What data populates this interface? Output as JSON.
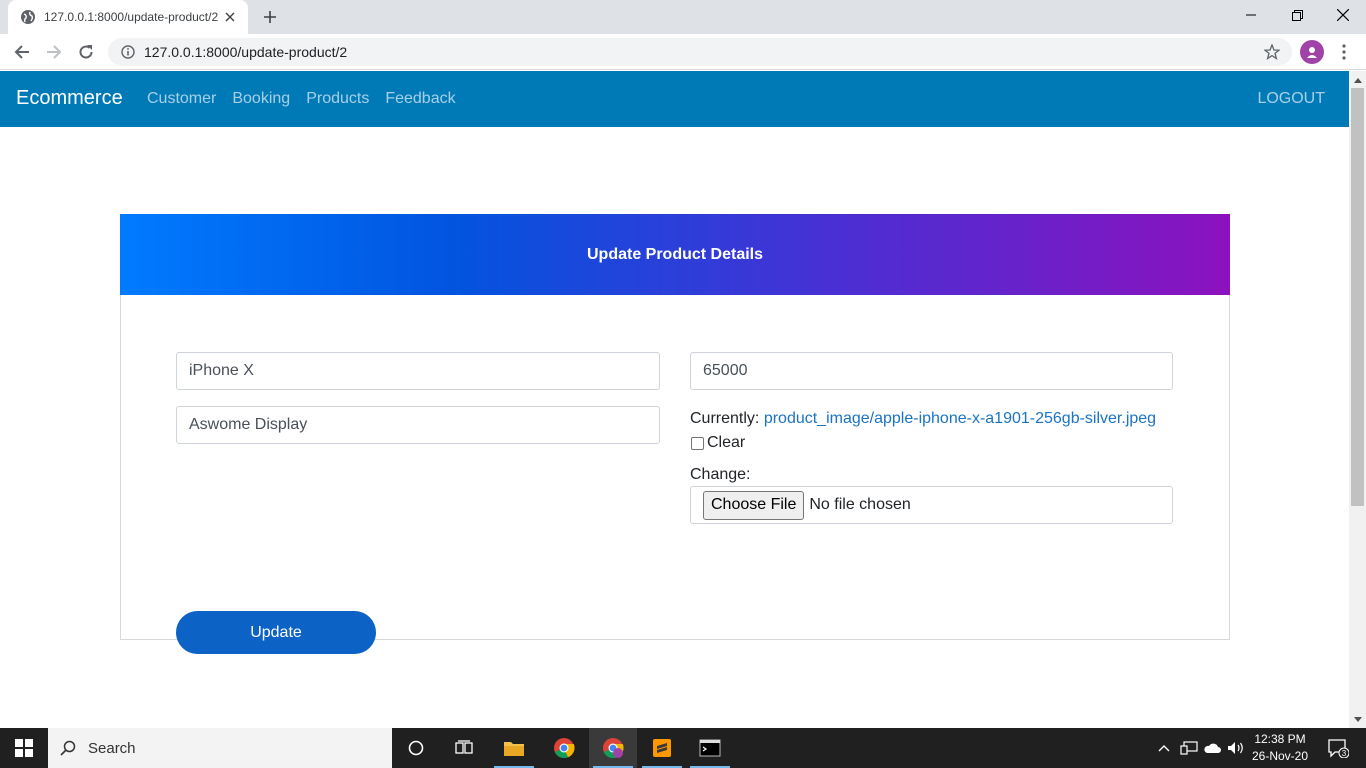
{
  "browser": {
    "tab_title": "127.0.0.1:8000/update-product/2",
    "url": "127.0.0.1:8000/update-product/2"
  },
  "navbar": {
    "brand": "Ecommerce",
    "links": [
      "Customer",
      "Booking",
      "Products",
      "Feedback"
    ],
    "logout": "LOGOUT"
  },
  "form": {
    "heading": "Update Product Details",
    "name_value": "iPhone X",
    "price_value": "65000",
    "description_value": "Aswome Display",
    "currently_label": "Currently:",
    "current_image": "product_image/apple-iphone-x-a1901-256gb-silver.jpeg",
    "clear_label": "Clear",
    "change_label": "Change:",
    "choose_file_label": "Choose File",
    "no_file_text": "No file chosen",
    "update_label": "Update"
  },
  "taskbar": {
    "search_text": "Search",
    "time": "12:38 PM",
    "date": "26-Nov-20",
    "notification_count": "3"
  },
  "colors": {
    "navbar": "#0079b7",
    "header_gradient_start": "#007bff",
    "header_gradient_end": "#8c12be",
    "update_button": "#0d62c5",
    "link": "#1a73c4"
  }
}
